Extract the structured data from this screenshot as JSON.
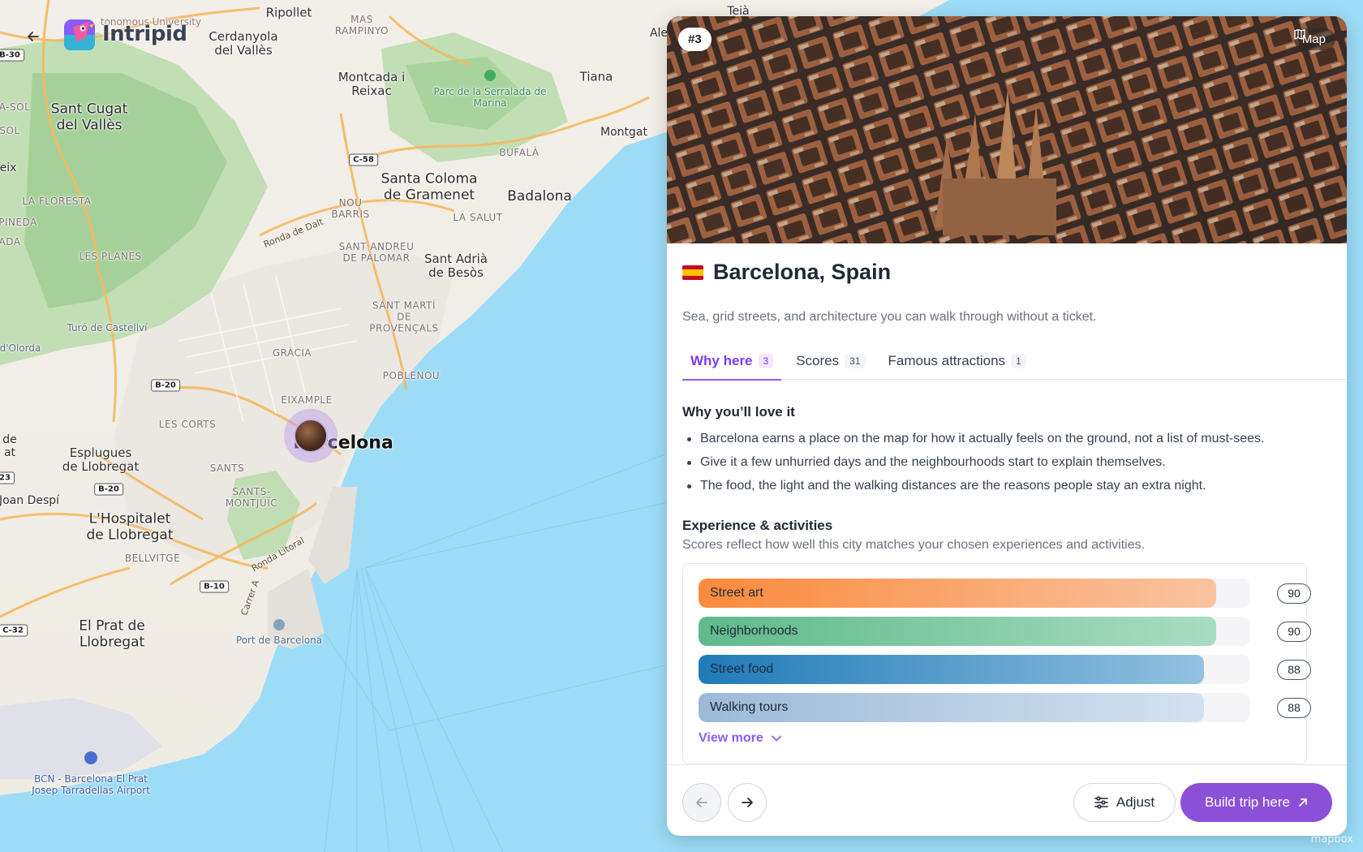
{
  "app": {
    "logo_text": "Intripid",
    "back_icon": "arrow-left-icon"
  },
  "map": {
    "labels": [
      {
        "id": "ripollet",
        "text": "Ripollet"
      },
      {
        "id": "cerdanyola",
        "text": "Cerdanyola del Vallès"
      },
      {
        "id": "mas-rampinyo",
        "text": "MAS RAMPINYO"
      },
      {
        "id": "univ",
        "text": "tonomous University"
      },
      {
        "id": "moncada",
        "text": "Montcada i Reixac"
      },
      {
        "id": "parc-serralada",
        "text": "Parc de la Serralada de Marina"
      },
      {
        "id": "tiana",
        "text": "Tiana"
      },
      {
        "id": "montgat",
        "text": "Montgat"
      },
      {
        "id": "teia",
        "text": "Teià"
      },
      {
        "id": "ale",
        "text": "Ale"
      },
      {
        "id": "sant-cugat",
        "text": "Sant Cugat del Vallès"
      },
      {
        "id": "a-sol",
        "text": "A-SOL"
      },
      {
        "id": "sol",
        "text": "SOL"
      },
      {
        "id": "eix",
        "text": "eix"
      },
      {
        "id": "santa-coloma",
        "text": "Santa Coloma de Gramenet"
      },
      {
        "id": "badalona",
        "text": "Badalona"
      },
      {
        "id": "bufala",
        "text": "BUFALÀ"
      },
      {
        "id": "nou-barris",
        "text": "NOU BARRIS"
      },
      {
        "id": "la-salut",
        "text": "LA SALUT"
      },
      {
        "id": "la-floresta",
        "text": "LA FLORESTA"
      },
      {
        "id": "pineda",
        "text": "PINEDA"
      },
      {
        "id": "ada",
        "text": "ADA"
      },
      {
        "id": "les-planes",
        "text": "LES PLANES"
      },
      {
        "id": "ronda-dalt",
        "text": "Ronda de Dalt"
      },
      {
        "id": "sant-andreu",
        "text": "SANT ANDREU DE PALOMAR"
      },
      {
        "id": "sant-adria",
        "text": "Sant Adrià de Besòs"
      },
      {
        "id": "sant-marti",
        "text": "SANT MARTÍ DE PROVENÇALS"
      },
      {
        "id": "turo",
        "text": "Turó de Castellví"
      },
      {
        "id": "olorda",
        "text": "d'Olorda"
      },
      {
        "id": "gracia",
        "text": "GRÀCIA"
      },
      {
        "id": "poblenou",
        "text": "POBLENOU"
      },
      {
        "id": "eixample",
        "text": "EIXAMPLE"
      },
      {
        "id": "les-corts",
        "text": "LES CORTS"
      },
      {
        "id": "esplugues",
        "text": "Esplugues de Llobregat"
      },
      {
        "id": "de-at",
        "text": "de at"
      },
      {
        "id": "sants",
        "text": "SANTS"
      },
      {
        "id": "sants-montjuic",
        "text": "SANTS-MONTJUÏC"
      },
      {
        "id": "joan-despi",
        "text": "Joan Despí"
      },
      {
        "id": "hospitalet",
        "text": "L'Hospitalet de Llobregat"
      },
      {
        "id": "bellvitge",
        "text": "BELLVITGE"
      },
      {
        "id": "ronda-litoral",
        "text": "Ronda Litoral"
      },
      {
        "id": "carrer-a",
        "text": "Carrer A"
      },
      {
        "id": "port",
        "text": "Port de Barcelona"
      },
      {
        "id": "el-prat",
        "text": "El Prat de Llobregat"
      },
      {
        "id": "bcn",
        "text": "BCN - Barcelona El Prat Josep Tarradellas Airport"
      },
      {
        "id": "barcelona",
        "text": "Barcelona"
      }
    ],
    "shields": [
      {
        "id": "c58",
        "text": "C-58"
      },
      {
        "id": "b20a",
        "text": "B-20"
      },
      {
        "id": "b20b",
        "text": "B-20"
      },
      {
        "id": "b10",
        "text": "B-10"
      },
      {
        "id": "c32",
        "text": "C-32"
      },
      {
        "id": "b30",
        "text": "B-30"
      },
      {
        "id": "x23",
        "text": "23"
      }
    ],
    "attribution": "mapbox"
  },
  "panel": {
    "rank": "#3",
    "map_button": "Map",
    "flag_icon": "spain-flag-icon",
    "city": "Barcelona, Spain",
    "subtitle": "Sea, grid streets, and architecture you can walk through without a ticket.",
    "tabs": [
      {
        "label": "Why here",
        "count": "3",
        "active": true
      },
      {
        "label": "Scores",
        "count": "31",
        "active": false
      },
      {
        "label": "Famous attractions",
        "count": "1",
        "active": false
      }
    ],
    "why_title": "Why you’ll love it",
    "why_items": [
      "Barcelona earns a place on the map for how it actually feels on the ground, not a list of must-sees.",
      "Give it a few unhurried days and the neighbourhoods start to explain themselves.",
      "The food, the light and the walking distances are the reasons people stay an extra night."
    ],
    "experience_title": "Experience & activities",
    "experience_desc": "Scores reflect how well this city matches your chosen experiences and activities.",
    "scores": [
      {
        "label": "Street art",
        "value": "90",
        "score": 90,
        "color_from": "#fb8a3c",
        "color_to": "#f9c3a0"
      },
      {
        "label": "Neighborhoods",
        "value": "90",
        "score": 90,
        "color_from": "#5fba8c",
        "color_to": "#a9dcc2"
      },
      {
        "label": "Street food",
        "value": "88",
        "score": 88,
        "color_from": "#1f7ab8",
        "color_to": "#93c1e0"
      },
      {
        "label": "Walking tours",
        "value": "88",
        "score": 88,
        "color_from": "#9cbad8",
        "color_to": "#d4e2f0"
      }
    ],
    "view_more": "View more",
    "footer": {
      "adjust": "Adjust",
      "build": "Build trip here"
    }
  },
  "colors": {
    "accent": "#8b5cf6",
    "build_button": "#8b4fd8",
    "water": "#9ddcf7",
    "land": "#f2efe9",
    "park": "#a8d5a0"
  }
}
